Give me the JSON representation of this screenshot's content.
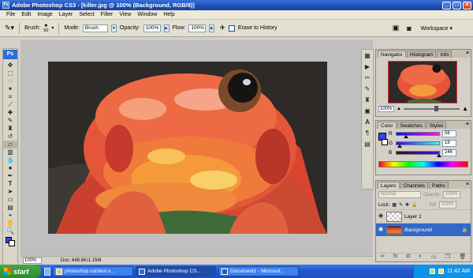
{
  "window": {
    "title": "Adobe Photoshop CS3 - [killer.jpg @ 100% (Background, RGB/8)]",
    "app_icon_text": "Ps"
  },
  "menu": [
    "File",
    "Edit",
    "Image",
    "Layer",
    "Select",
    "Filter",
    "View",
    "Window",
    "Help"
  ],
  "options": {
    "brush_label": "Brush:",
    "brush_size": "50",
    "mode_label": "Mode:",
    "mode_value": "Brush",
    "opacity_label": "Opacity:",
    "opacity_value": "100%",
    "flow_label": "Flow:",
    "flow_value": "100%",
    "erase_history_label": "Erase to History",
    "workspace_label": "Workspace ▾"
  },
  "toolbox": {
    "logo": "Ps"
  },
  "document": {
    "zoom": "100%",
    "doc_size": "Doc: 648.6K/1.15M"
  },
  "navigator": {
    "tabs": [
      "Navigator",
      "Histogram",
      "Info"
    ],
    "zoom": "100%",
    "zoom_level": 0.55
  },
  "color": {
    "tabs": [
      "Color",
      "Swatches",
      "Styles"
    ],
    "fg_color": "#3844f6",
    "channels": [
      {
        "name": "R",
        "value": "56"
      },
      {
        "name": "G",
        "value": "18"
      },
      {
        "name": "B",
        "value": "246"
      }
    ]
  },
  "layers": {
    "tabs": [
      "Layers",
      "Channels",
      "Paths"
    ],
    "blend_mode": "Normal",
    "opacity_label": "Opacity:",
    "opacity_value": "100%",
    "lock_label": "Lock:",
    "fill_label": "Fill:",
    "fill_value": "100%",
    "items": [
      {
        "name": "Layer 1",
        "active": false
      },
      {
        "name": "Background",
        "active": true
      }
    ]
  },
  "taskbar": {
    "start_label": "start",
    "buttons": [
      {
        "label": "photoshop contest o...",
        "active": false
      },
      {
        "label": "Adobe Photoshop CS...",
        "active": true
      },
      {
        "label": "Document1 - Microsof...",
        "active": false
      }
    ],
    "clock": "11:42 AM"
  }
}
